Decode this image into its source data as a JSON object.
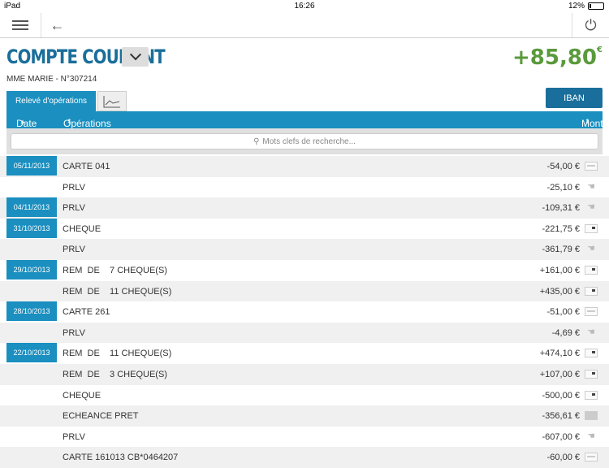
{
  "status": {
    "carrier": "iPad",
    "time": "16:26",
    "battery": "12%"
  },
  "account": {
    "title": "COMPTE COURANT",
    "balance": "+85,80",
    "currency": "€",
    "holder": "MME MARIE - N°307214"
  },
  "tabs": {
    "operations": "Relevé d'opérations"
  },
  "iban_label": "IBAN",
  "table": {
    "col_date": "Date",
    "col_operations": "Opérations",
    "col_amount": "Montant"
  },
  "search": {
    "placeholder": "Mots clefs de recherche..."
  },
  "rows": [
    {
      "date": "05/11/2013",
      "label": "CARTE 041",
      "amount": "-54,00 €",
      "icon": "card-icon"
    },
    {
      "date": "",
      "label": "PRLV",
      "amount": "-25,10 €",
      "icon": "hand-icon"
    },
    {
      "date": "04/11/2013",
      "label": "PRLV",
      "amount": "-109,31 €",
      "icon": "hand-icon"
    },
    {
      "date": "31/10/2013",
      "label": "CHEQUE",
      "amount": "-221,75 €",
      "icon": "cheque-icon"
    },
    {
      "date": "",
      "label": "PRLV",
      "amount": "-361,79 €",
      "icon": "hand-icon"
    },
    {
      "date": "29/10/2013",
      "label": "REM  DE    7 CHEQUE(S)",
      "amount": "+161,00 €",
      "icon": "cheque-icon"
    },
    {
      "date": "",
      "label": "REM  DE    11 CHEQUE(S)",
      "amount": "+435,00 €",
      "icon": "cheque-icon"
    },
    {
      "date": "28/10/2013",
      "label": "CARTE 261",
      "amount": "-51,00 €",
      "icon": "card-icon"
    },
    {
      "date": "",
      "label": "PRLV",
      "amount": "-4,69 €",
      "icon": "hand-icon"
    },
    {
      "date": "22/10/2013",
      "label": "REM  DE    11 CHEQUE(S)",
      "amount": "+474,10 €",
      "icon": "cheque-icon"
    },
    {
      "date": "",
      "label": "REM  DE    3 CHEQUE(S)",
      "amount": "+107,00 €",
      "icon": "cheque-icon"
    },
    {
      "date": "",
      "label": "CHEQUE",
      "amount": "-500,00 €",
      "icon": "cheque-icon"
    },
    {
      "date": "",
      "label": "ECHEANCE PRET",
      "amount": "-356,61 €",
      "icon": "loan-icon"
    },
    {
      "date": "",
      "label": "PRLV",
      "amount": "-607,00 €",
      "icon": "hand-icon"
    },
    {
      "date": "",
      "label": "CARTE 161013 CB*0464207",
      "amount": "-60,00 €",
      "icon": "card-icon"
    }
  ]
}
